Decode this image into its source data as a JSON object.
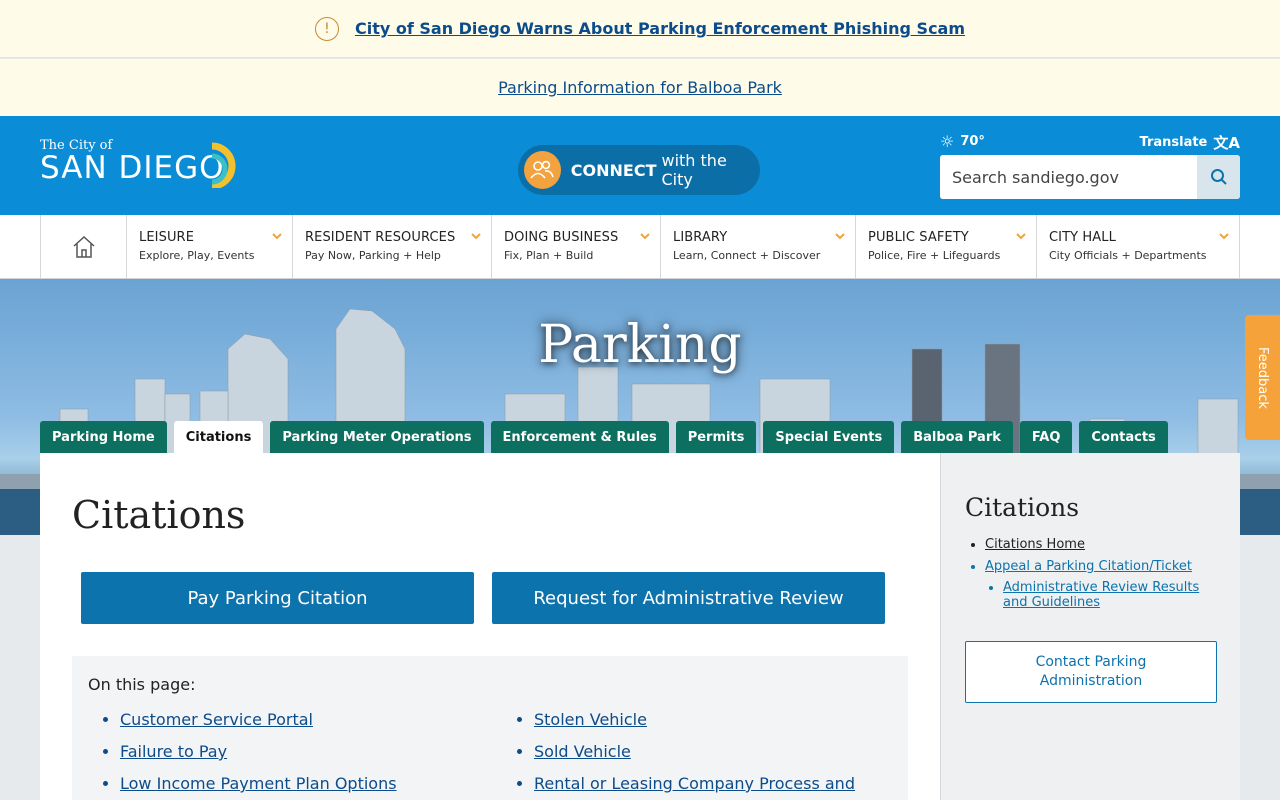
{
  "alerts": {
    "scam_link": "City of San Diego Warns About Parking Enforcement Phishing Scam",
    "warn_icon": "!",
    "balboa_link": "Parking Information for Balboa Park"
  },
  "header": {
    "logo_small": "The City of",
    "logo_big": "SAN DIEGO",
    "connect_bold": "CONNECT",
    "connect_rest": "with the City",
    "weather": "70°",
    "translate": "Translate",
    "search_placeholder": "Search sandiego.gov"
  },
  "nav": {
    "items": [
      {
        "title": "LEISURE",
        "sub": "Explore, Play, Events"
      },
      {
        "title": "RESIDENT RESOURCES",
        "sub": "Pay Now, Parking + Help"
      },
      {
        "title": "DOING BUSINESS",
        "sub": "Fix, Plan + Build"
      },
      {
        "title": "LIBRARY",
        "sub": "Learn, Connect + Discover"
      },
      {
        "title": "PUBLIC SAFETY",
        "sub": "Police, Fire + Lifeguards"
      },
      {
        "title": "CITY HALL",
        "sub": "City Officials + Departments"
      }
    ]
  },
  "hero": {
    "title": "Parking"
  },
  "tabs": [
    "Parking Home",
    "Citations",
    "Parking Meter Operations",
    "Enforcement & Rules",
    "Permits",
    "Special Events",
    "Balboa Park",
    "FAQ",
    "Contacts"
  ],
  "main": {
    "title": "Citations",
    "pay_button": "Pay Parking Citation",
    "review_button": "Request for Administrative Review",
    "on_this_page": "On this page:",
    "links_left": [
      "Customer Service Portal",
      "Failure to Pay",
      "Low Income Payment Plan Options"
    ],
    "links_right": [
      "Stolen Vehicle",
      "Sold Vehicle",
      "Rental or Leasing Company Process and"
    ]
  },
  "sidebar": {
    "title": "Citations",
    "home_link": "Citations Home",
    "appeal_link": "Appeal a Parking Citation/Ticket",
    "review_link": "Administrative Review Results and Guidelines",
    "contact_button": "Contact Parking Administration"
  },
  "feedback": "Feedback",
  "colors": {
    "header_blue": "#0a8dd6",
    "tab_green": "#0c6f5f",
    "button_blue": "#0d73ad",
    "accent_orange": "#f2a23e"
  }
}
